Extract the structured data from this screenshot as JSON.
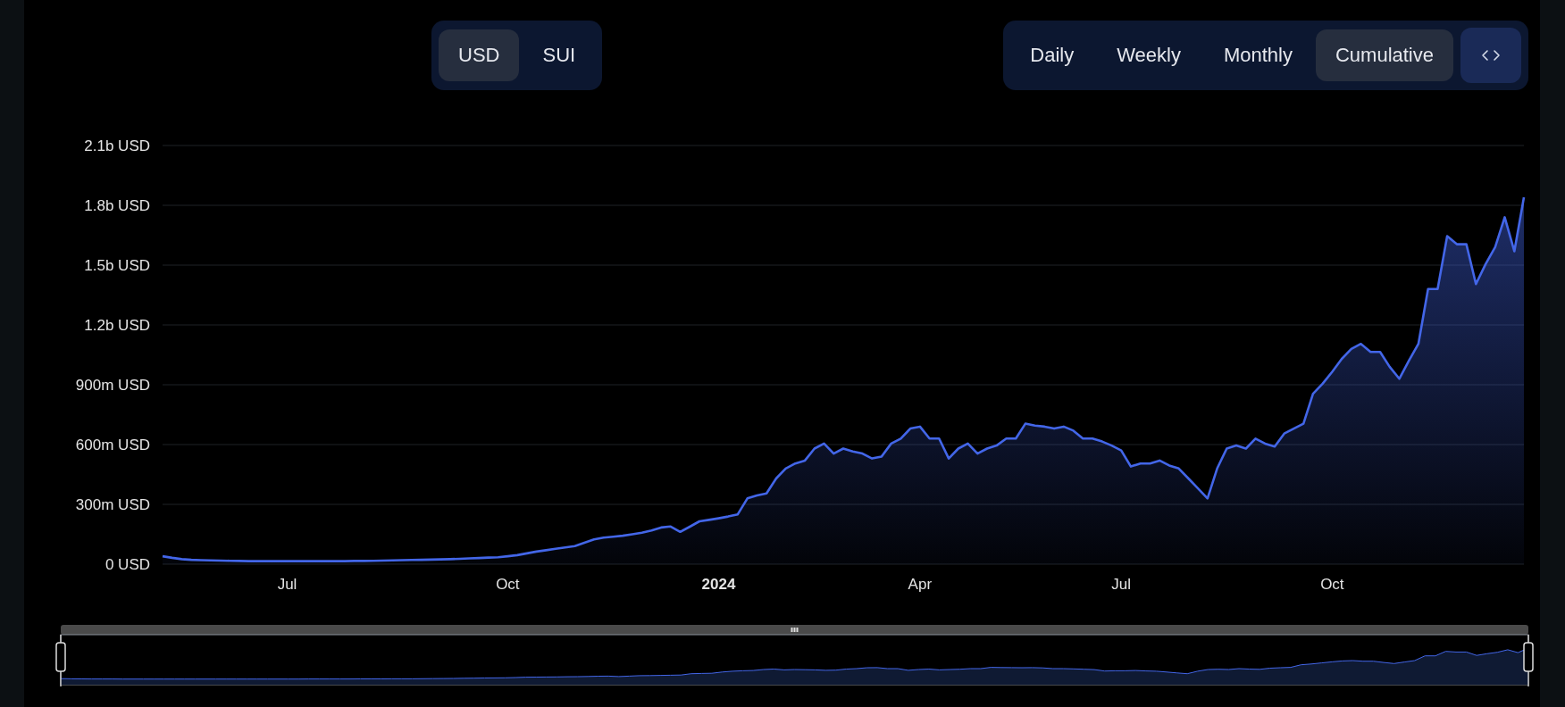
{
  "currency_toggle": [
    {
      "label": "USD",
      "selected": true
    },
    {
      "label": "SUI",
      "selected": false
    }
  ],
  "period_toggle": [
    {
      "label": "Daily",
      "selected": false
    },
    {
      "label": "Weekly",
      "selected": false
    },
    {
      "label": "Monthly",
      "selected": false
    },
    {
      "label": "Cumulative",
      "selected": true
    }
  ],
  "chart": {
    "chart_data": {
      "type": "area",
      "categories": [
        null,
        null,
        null,
        null,
        null,
        null,
        null,
        null,
        null,
        null,
        null,
        null,
        null,
        "Jul",
        null,
        null,
        null,
        null,
        null,
        null,
        null,
        null,
        null,
        null,
        null,
        null,
        null,
        null,
        null,
        null,
        null,
        null,
        null,
        null,
        null,
        null,
        "Oct",
        null,
        null,
        null,
        null,
        null,
        null,
        null,
        null,
        null,
        null,
        null,
        null,
        null,
        null,
        null,
        null,
        null,
        null,
        null,
        null,
        null,
        "2024",
        null,
        null,
        null,
        null,
        null,
        null,
        null,
        null,
        null,
        null,
        null,
        null,
        null,
        null,
        null,
        null,
        null,
        null,
        null,
        null,
        "Apr",
        null,
        null,
        null,
        null,
        null,
        null,
        null,
        null,
        null,
        null,
        null,
        null,
        null,
        null,
        null,
        null,
        null,
        null,
        null,
        null,
        "Jul",
        null,
        null,
        null,
        null,
        null,
        null,
        null,
        null,
        null,
        null,
        null,
        null,
        null,
        null,
        null,
        null,
        null,
        null,
        null,
        null,
        null,
        "Oct",
        null,
        null,
        null,
        null,
        null,
        null,
        null,
        null,
        null,
        null,
        null,
        null,
        null,
        null,
        null,
        null,
        null,
        null,
        null,
        null
      ],
      "series": [
        {
          "color": "#4366e8",
          "values": [
            40000000,
            32000000,
            25000000,
            22000000,
            20000000,
            19000000,
            18000000,
            17000000,
            16000000,
            15000000,
            15000000,
            15000000,
            15000000,
            15000000,
            15000000,
            15000000,
            15000000,
            15000000,
            15000000,
            15000000,
            16000000,
            16000000,
            17000000,
            18000000,
            19000000,
            20000000,
            21000000,
            22000000,
            23000000,
            24000000,
            25000000,
            27000000,
            29000000,
            31000000,
            33000000,
            35000000,
            40000000,
            45000000,
            54000000,
            63000000,
            70000000,
            77000000,
            84000000,
            91000000,
            107000000,
            124000000,
            133000000,
            138000000,
            143000000,
            150000000,
            158000000,
            169000000,
            184000000,
            189000000,
            162000000,
            188000000,
            215000000,
            222000000,
            230000000,
            239000000,
            250000000,
            330000000,
            345000000,
            355000000,
            430000000,
            480000000,
            505000000,
            520000000,
            580000000,
            605000000,
            555000000,
            580000000,
            565000000,
            555000000,
            530000000,
            540000000,
            605000000,
            630000000,
            680000000,
            690000000,
            630000000,
            630000000,
            530000000,
            580000000,
            605000000,
            555000000,
            580000000,
            595000000,
            630000000,
            630000000,
            705000000,
            695000000,
            690000000,
            680000000,
            690000000,
            670000000,
            630000000,
            630000000,
            615000000,
            595000000,
            570000000,
            490000000,
            505000000,
            505000000,
            520000000,
            495000000,
            480000000,
            430000000,
            380000000,
            330000000,
            480000000,
            580000000,
            595000000,
            580000000,
            630000000,
            605000000,
            590000000,
            655000000,
            680000000,
            705000000,
            855000000,
            905000000,
            965000000,
            1030000000,
            1080000000,
            1105000000,
            1065000000,
            1065000000,
            990000000,
            930000000,
            1020000000,
            1105000000,
            1380000000,
            1380000000,
            1645000000,
            1605000000,
            1605000000,
            1405000000,
            1505000000,
            1590000000,
            1740000000,
            1570000000,
            1840000000
          ]
        }
      ],
      "grid": true,
      "ylim": [
        0,
        2100000000
      ],
      "yticks": [
        {
          "value": 0,
          "label": "0 USD"
        },
        {
          "value": 300000000,
          "label": "300m USD"
        },
        {
          "value": 600000000,
          "label": "600m USD"
        },
        {
          "value": 900000000,
          "label": "900m USD"
        },
        {
          "value": 1200000000,
          "label": "1.2b USD"
        },
        {
          "value": 1500000000,
          "label": "1.5b USD"
        },
        {
          "value": 1800000000,
          "label": "1.8b USD"
        },
        {
          "value": 2100000000,
          "label": "2.1b USD"
        }
      ]
    }
  }
}
